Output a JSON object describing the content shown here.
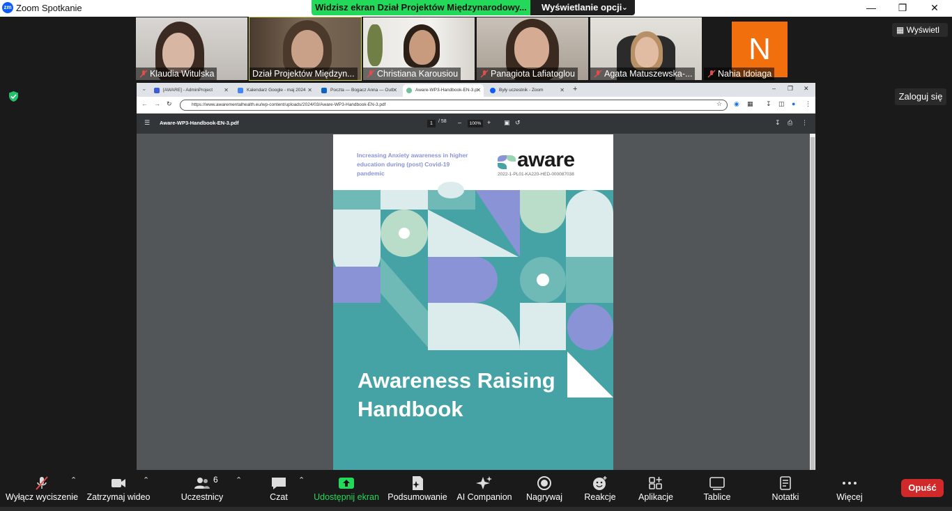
{
  "app": {
    "title": "Zoom Spotkanie",
    "logo": "zm"
  },
  "banner": {
    "sharing_text": "Widzisz ekran Dział Projektów Międzynarodowy...",
    "view_options": "Wyświetlanie opcji"
  },
  "window": {
    "minimize": "—",
    "restore": "❐",
    "close": "✕"
  },
  "participants": [
    {
      "name": "Klaudia Witulska"
    },
    {
      "name": "Dział Projektów Międzyn..."
    },
    {
      "name": "Christiana Karousiou"
    },
    {
      "name": "Panagiota Lafiatoglou"
    },
    {
      "name": "Agata Matuszewska-..."
    },
    {
      "name": "Nahia Idoiaga",
      "initial": "N"
    }
  ],
  "side": {
    "view_button": "Wyświetl",
    "login_button": "Zaloguj się"
  },
  "browser": {
    "tabs": [
      {
        "label": "[AWARE] - AdminProject"
      },
      {
        "label": "Kalendarz Google - maj 2024"
      },
      {
        "label": "Poczta — Bogacz Anna — Outl"
      },
      {
        "label": "Aware-WP3-Handbook-EN-3.p"
      },
      {
        "label": "Były uczestnik - Zoom"
      }
    ],
    "url": "https://www.awarementalhealth.eu/wp-content/uploads/2024/03/Aware-WP3-Handbook-EN-3.pdf"
  },
  "pdf": {
    "filename": "Aware-WP3-Handbook-EN-3.pdf",
    "page_current": "1",
    "page_total": "/ 58",
    "zoom": "100%",
    "subtitle": "Increasing Anxiety awareness in higher education during (post) Covid-19 pandemic",
    "logo_text": "aware",
    "grant_code": "2022-1-PL01-KA220-HED-000087038",
    "title_line1": "Awareness Raising",
    "title_line2": "Handbook"
  },
  "toolbar": {
    "mute": "Wyłącz wyciszenie",
    "video": "Zatrzymaj wideo",
    "participants": "Uczestnicy",
    "participants_count": "6",
    "chat": "Czat",
    "share": "Udostępnij ekran",
    "summary": "Podsumowanie",
    "ai": "AI Companion",
    "record": "Nagrywaj",
    "reactions": "Reakcje",
    "apps": "Aplikacje",
    "whiteboards": "Tablice",
    "notes": "Notatki",
    "more": "Więcej",
    "leave": "Opuść"
  },
  "colors": {
    "share_green": "#23d959",
    "leave_red": "#d12929",
    "pdf_teal": "#45a3a5",
    "avatar_orange": "#f26f0d"
  }
}
